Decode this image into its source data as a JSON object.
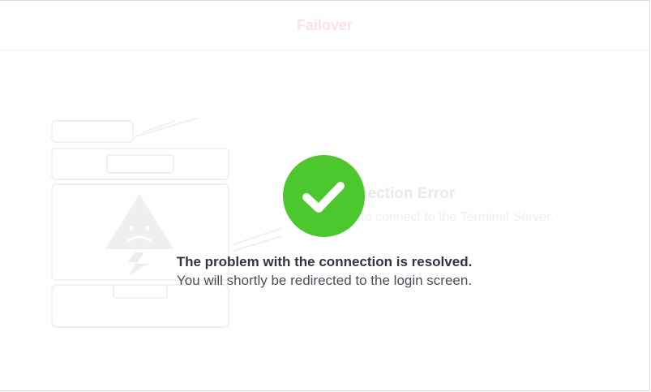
{
  "header": {
    "title": "Failover"
  },
  "background_error": {
    "title": "Connection Error",
    "subtitle": "Unable to connect to the Terminal Server."
  },
  "icons": {
    "success": "checkmark-circle-icon",
    "illustration": "broken-server-icon",
    "warning": "warning-triangle-icon"
  },
  "message": {
    "title": "The problem with the connection is resolved.",
    "subtitle": "You will shortly be redirected to the login screen."
  },
  "colors": {
    "success": "#4cc72e",
    "header_title": "#fbe3df",
    "message_title": "#2f3542",
    "message_subtitle": "#4a4f5a"
  }
}
